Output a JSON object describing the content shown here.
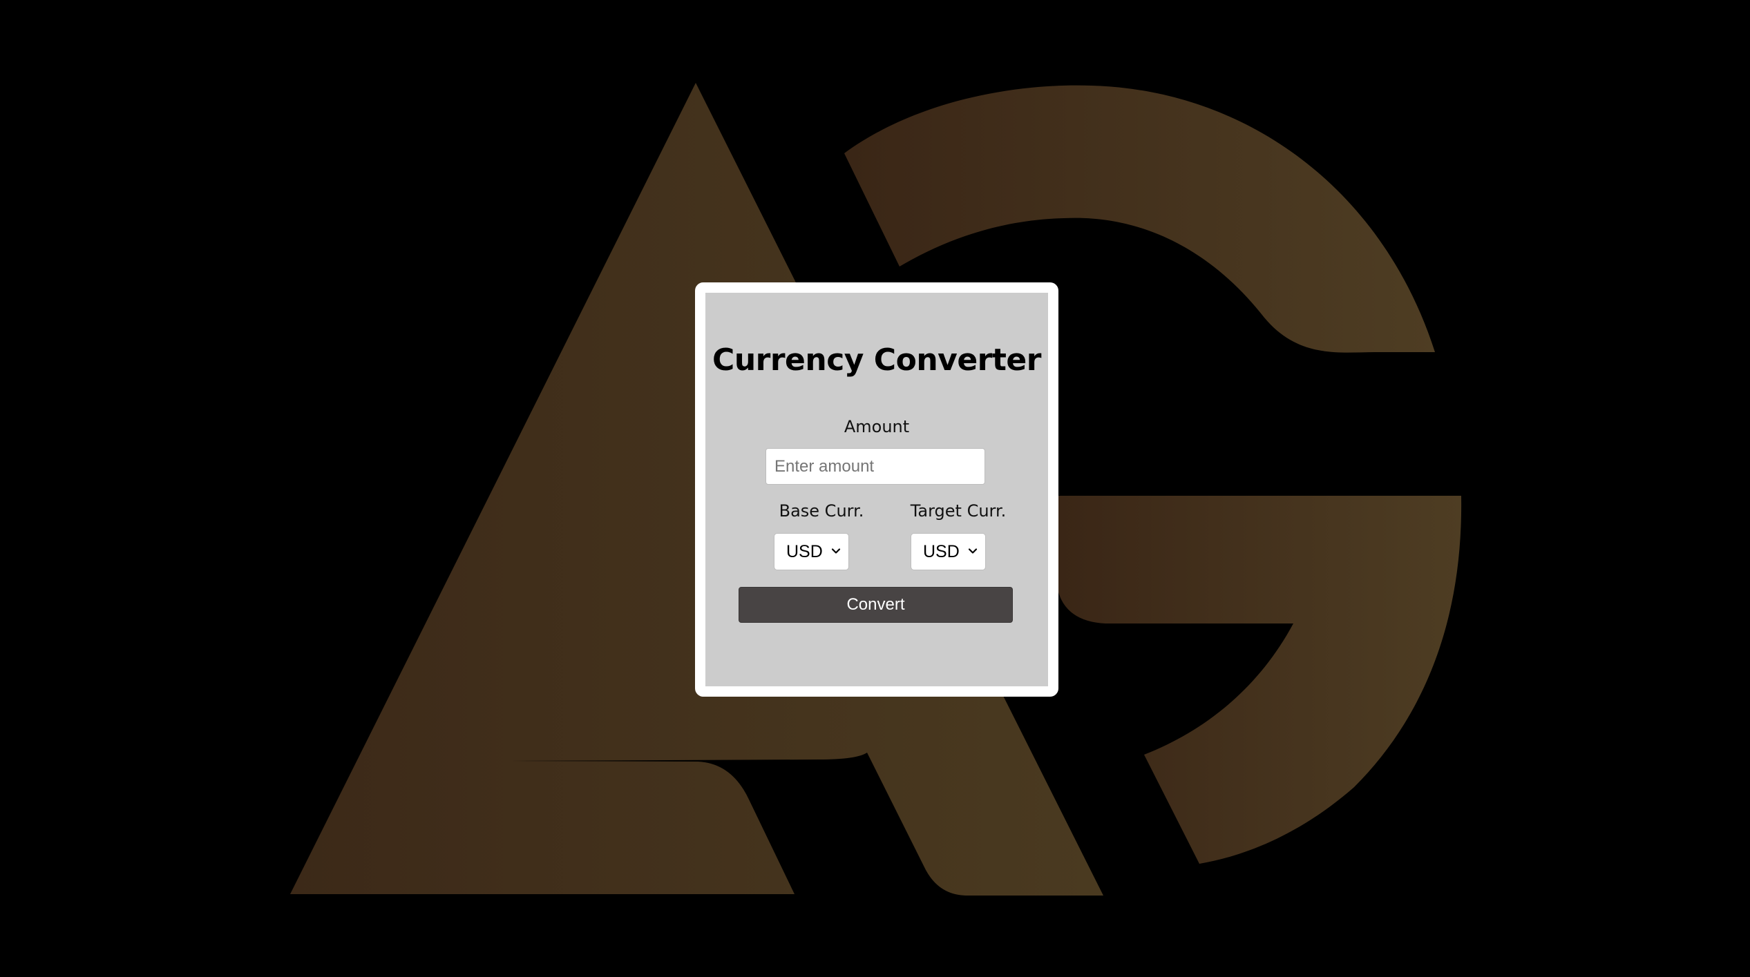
{
  "app": {
    "title": "Currency Converter"
  },
  "form": {
    "amount_label": "Amount",
    "amount_placeholder": "Enter amount",
    "amount_value": "",
    "base_label": "Base Curr.",
    "base_selected": "USD",
    "target_label": "Target Curr.",
    "target_selected": "USD",
    "convert_label": "Convert"
  },
  "icons": {
    "background_logo": "ag-logo",
    "select_arrow": "chevron-down-icon"
  },
  "colors": {
    "page_background": "#000000",
    "logo_dark": "#3e2a18",
    "logo_light": "#4e3d22",
    "card_border": "#ffffff",
    "card_background": "#cccccc",
    "button_background": "#484444",
    "button_text": "#ffffff"
  }
}
